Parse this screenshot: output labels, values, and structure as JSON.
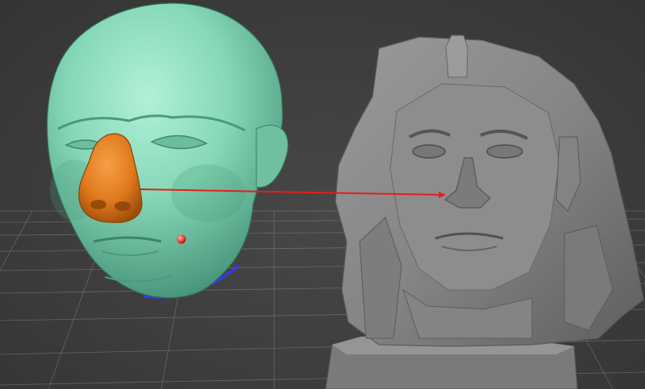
{
  "viewport": {
    "background_color": "#3f3f3f",
    "grid_color": "#9a9a9a"
  },
  "scene": {
    "objects": [
      {
        "name": "reference-head",
        "color": "#7fd6b4"
      },
      {
        "name": "nose-selection",
        "color": "#e07a1e"
      },
      {
        "name": "scanned-bust",
        "color": "#8a8a8a"
      }
    ],
    "correspondence": {
      "arrow_color": "#e41e1e",
      "from": "nose-selection",
      "to": "scanned-bust-nose"
    },
    "markers": [
      {
        "name": "landmark-point",
        "color": "#ff4a4a"
      }
    ],
    "neck_outline_color": "#2d3cff"
  }
}
